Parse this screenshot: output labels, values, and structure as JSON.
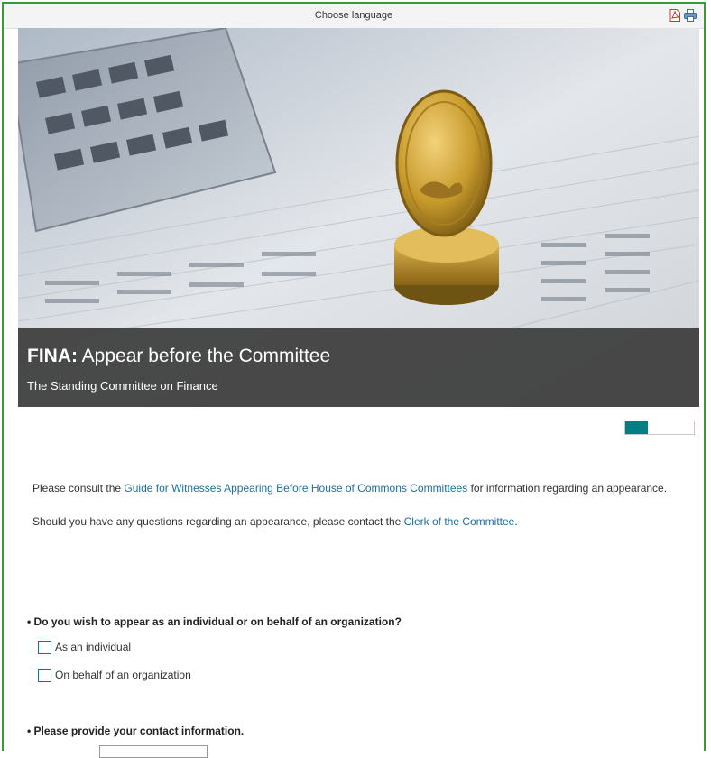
{
  "topbar": {
    "language_label": "Choose language",
    "icons": [
      "pdf-icon",
      "print-icon"
    ]
  },
  "hero": {
    "title_bold": "FINA:",
    "title_rest": " Appear before the Committee",
    "subtitle": "The Standing Committee on Finance"
  },
  "progress": {
    "fraction": 0.33,
    "fill_color": "#007f82"
  },
  "intro": {
    "line1_pre": "Please consult the ",
    "line1_link": "Guide for Witnesses Appearing Before House of Commons Committees",
    "line1_post": " for information regarding an appearance.",
    "line2_pre": "Should you have any questions regarding an appearance, please contact the ",
    "line2_link": "Clerk of the Committee",
    "line2_post": "."
  },
  "question1": {
    "label": "• Do you wish to appear as an individual or on behalf of an organization?",
    "options": [
      "As an individual",
      "On behalf of an organization"
    ]
  },
  "question2": {
    "label": "• Please provide your contact information."
  },
  "colors": {
    "accent": "#007f82",
    "link": "#1b6f9e",
    "frame": "#3a9a3a"
  }
}
